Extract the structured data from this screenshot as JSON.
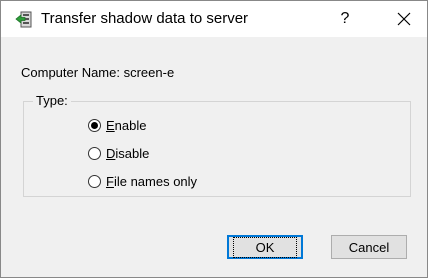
{
  "window": {
    "title": "Transfer shadow data to server",
    "help_label": "?",
    "close_icon": "close-icon",
    "app_icon": "transfer-shadow-icon"
  },
  "computer_name": {
    "label": "Computer Name: screen-e"
  },
  "type_group": {
    "legend": "Type:",
    "options": [
      {
        "mnemonic": "E",
        "rest": "nable",
        "checked": true
      },
      {
        "mnemonic": "D",
        "rest": "isable",
        "checked": false
      },
      {
        "mnemonic": "F",
        "rest": "ile names only",
        "checked": false
      }
    ]
  },
  "buttons": {
    "ok_label": "OK",
    "cancel_label": "Cancel"
  },
  "colors": {
    "accent": "#0078d7",
    "icon_green": "#2e9e3a"
  }
}
